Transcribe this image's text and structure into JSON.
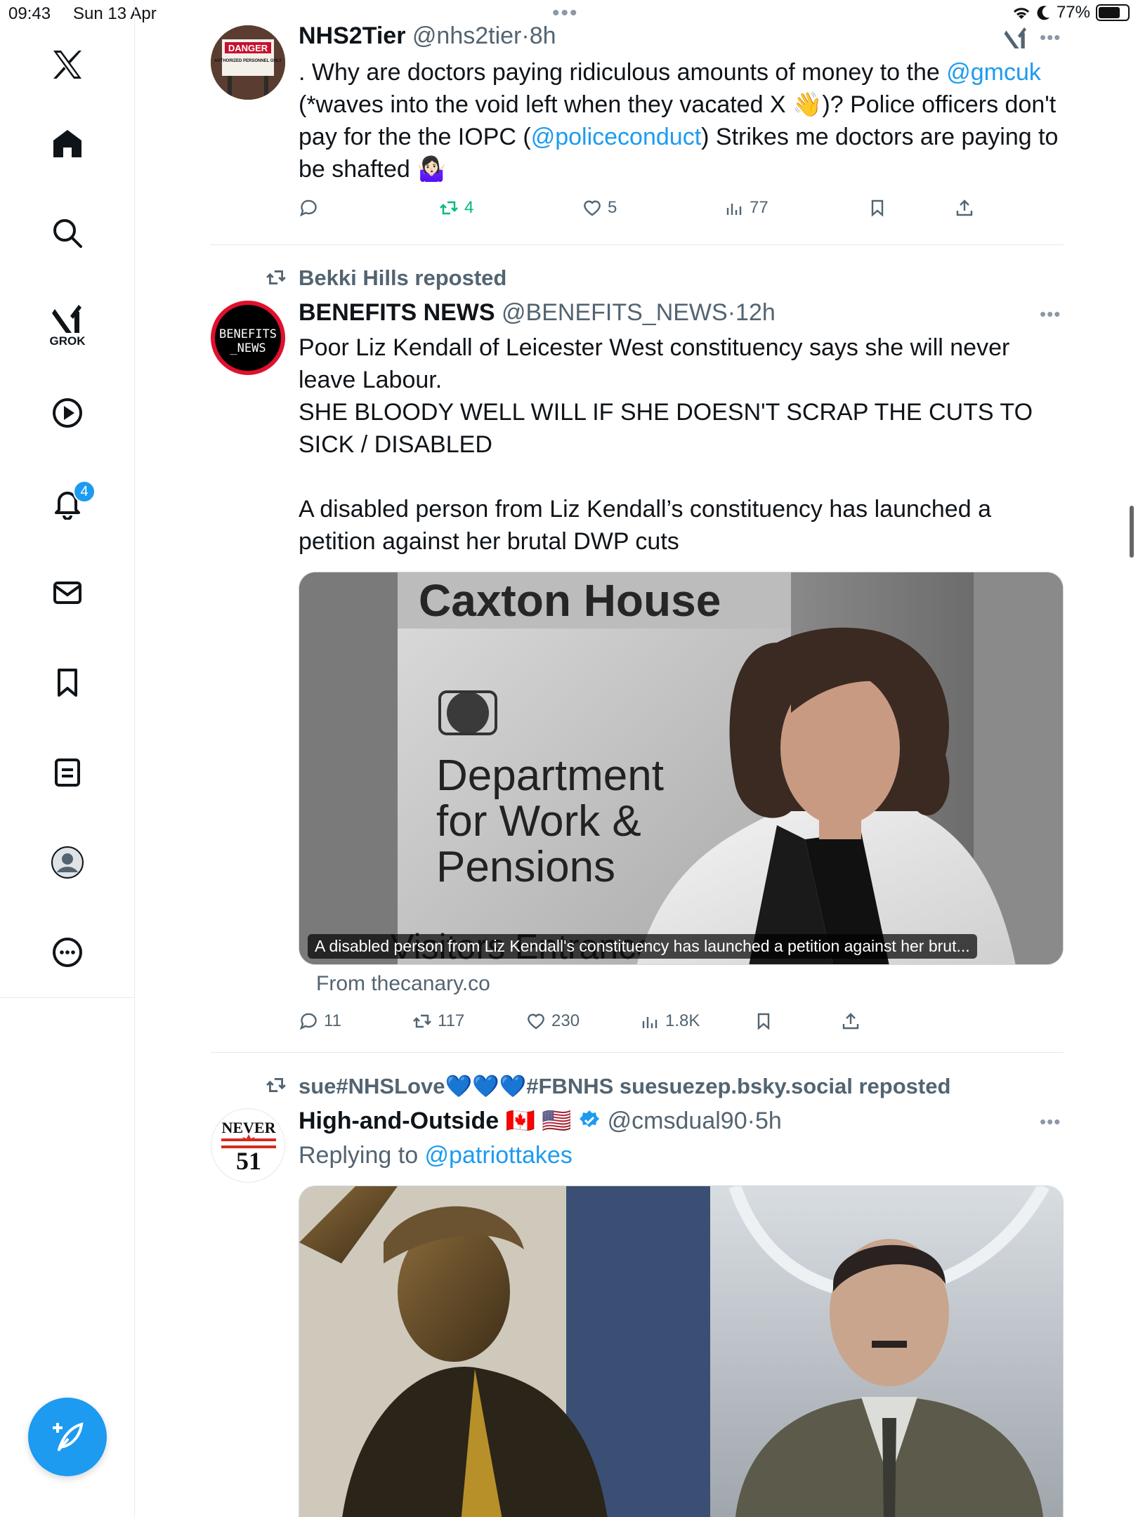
{
  "status_bar": {
    "time": "09:43",
    "date": "Sun 13 Apr",
    "battery": "77%",
    "battery_level": 0.77
  },
  "sidebar": {
    "grok_label": "GROK",
    "notifications_badge": "4"
  },
  "tweets": [
    {
      "name": "NHS2Tier",
      "handle": "@nhs2tier",
      "time": "8h",
      "text": {
        "p1": ". Why are doctors paying ridiculous amounts of money to the ",
        "link1": "@gmcuk",
        "p2": " (*waves into the void left when they vacated X 👋)? Police officers don't pay for the the IOPC (",
        "link2": "@policeconduct",
        "p3": ") Strikes me doctors are paying to be shafted 🤷🏻‍♀️"
      },
      "avatar_sign": {
        "top": "DANGER",
        "bottom": "AUTHORIZED PERSONNEL ONLY"
      },
      "stats": {
        "replies": "",
        "reposts": "4",
        "likes": "5",
        "views": "77"
      }
    },
    {
      "reposted_by": "Bekki Hills reposted",
      "name": "BENEFITS NEWS",
      "handle": "@BENEFITS_NEWS",
      "time": "12h",
      "avatar_text": {
        "line1": "BENEFITS",
        "line2": "_NEWS"
      },
      "text": {
        "line1": "Poor Liz Kendall of Leicester West constituency says she will never leave Labour.",
        "line2": "SHE BLOODY WELL WILL IF SHE DOESN'T SCRAP THE CUTS TO SICK / DISABLED",
        "line3": "A disabled person from Liz Kendall’s constituency has launched a petition against her brutal DWP cuts"
      },
      "media": {
        "sign_title": "Caxton House",
        "sign_line1": "Department",
        "sign_line2": "for Work &",
        "sign_line3": "Pensions",
        "sign_bottom": "Visitors Entrance",
        "caption": "A disabled person from Liz Kendall's constituency has launched a petition against her brut..."
      },
      "source": "From thecanary.co",
      "stats": {
        "replies": "11",
        "reposts": "117",
        "likes": "230",
        "views": "1.8K"
      }
    },
    {
      "reposted_by": "sue#NHSLove💙💙💙#FBNHS suesuezep.bsky.social reposted",
      "name": "High-and-Outside 🇨🇦 🇺🇸",
      "handle": "@cmsdual90",
      "time": "5h",
      "replying_prefix": "Replying to ",
      "replying_to": "@patriottakes",
      "avatar_text": {
        "top": "NEVER",
        "bottom": "51"
      }
    }
  ]
}
